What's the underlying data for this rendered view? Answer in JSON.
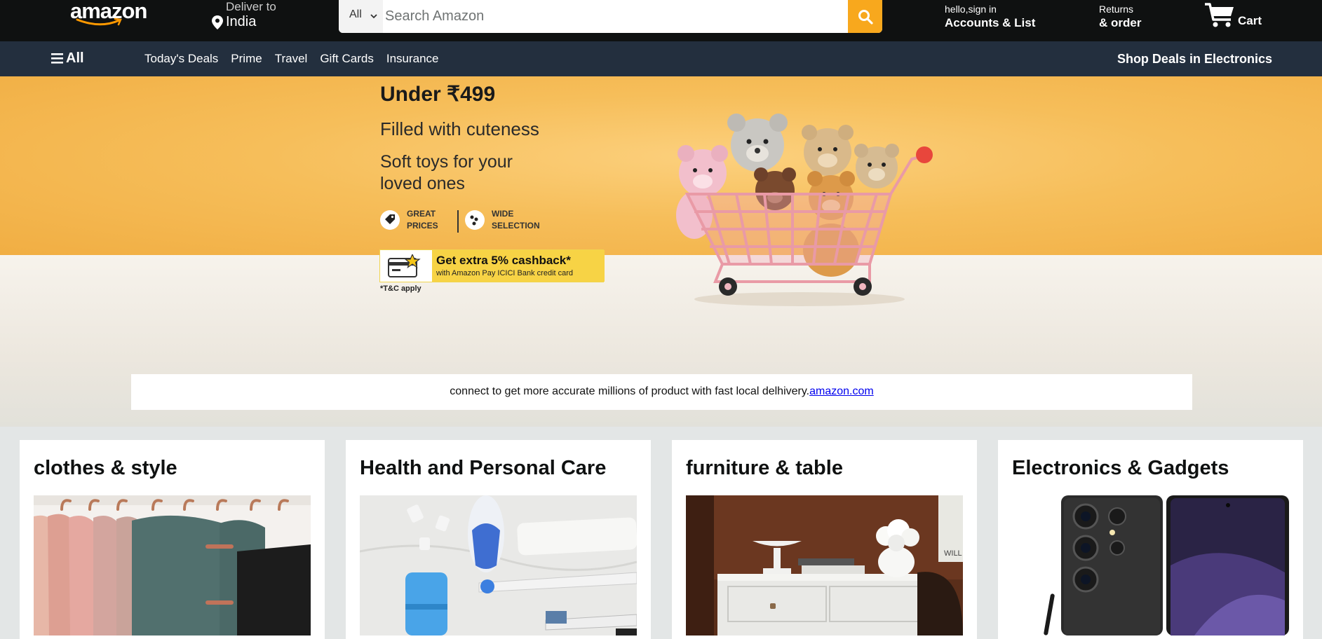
{
  "header": {
    "logo_text": "amazon",
    "deliver_label": "Deliver to",
    "deliver_location": "India",
    "search": {
      "category": "All",
      "placeholder": "Search Amazon"
    },
    "account_greeting": "hello,sign in",
    "account_label": "Accounts & List",
    "returns_line1": "Returns",
    "returns_line2": "& order",
    "cart_label": "Cart"
  },
  "subnav": {
    "all_label": "All",
    "links": [
      "Today's Deals",
      "Prime",
      "Travel",
      "Gift Cards",
      "Insurance"
    ],
    "promo": "Shop Deals in Electronics"
  },
  "hero": {
    "title": "Under ₹499",
    "subtitle": "Filled with cuteness",
    "description": "Soft toys for your loved ones",
    "feature_1": "GREAT PRICES",
    "feature_2": "WIDE SELECTION",
    "cashback_line1": "Get extra 5% cashback*",
    "cashback_line2": "with Amazon Pay ICICI Bank credit card",
    "tnc": "*T&C apply",
    "note_text": "connect to get more accurate millions of product with fast local delhivery.",
    "note_link": "amazon.com"
  },
  "cards": [
    {
      "title": "clothes & style"
    },
    {
      "title": "Health and Personal Care"
    },
    {
      "title": "furniture & table"
    },
    {
      "title": "Electronics & Gadgets"
    }
  ],
  "colors": {
    "nav_top": "#0f1111",
    "nav_sub": "#232f3e",
    "search_button": "#f8a81d",
    "page_bg": "#e3e6e6"
  },
  "icons": [
    "amazon-smile-icon",
    "location-pin-icon",
    "chevron-down-icon",
    "search-icon",
    "cart-icon",
    "hamburger-icon",
    "price-tag-icon",
    "selection-icon",
    "credit-card-icon"
  ]
}
